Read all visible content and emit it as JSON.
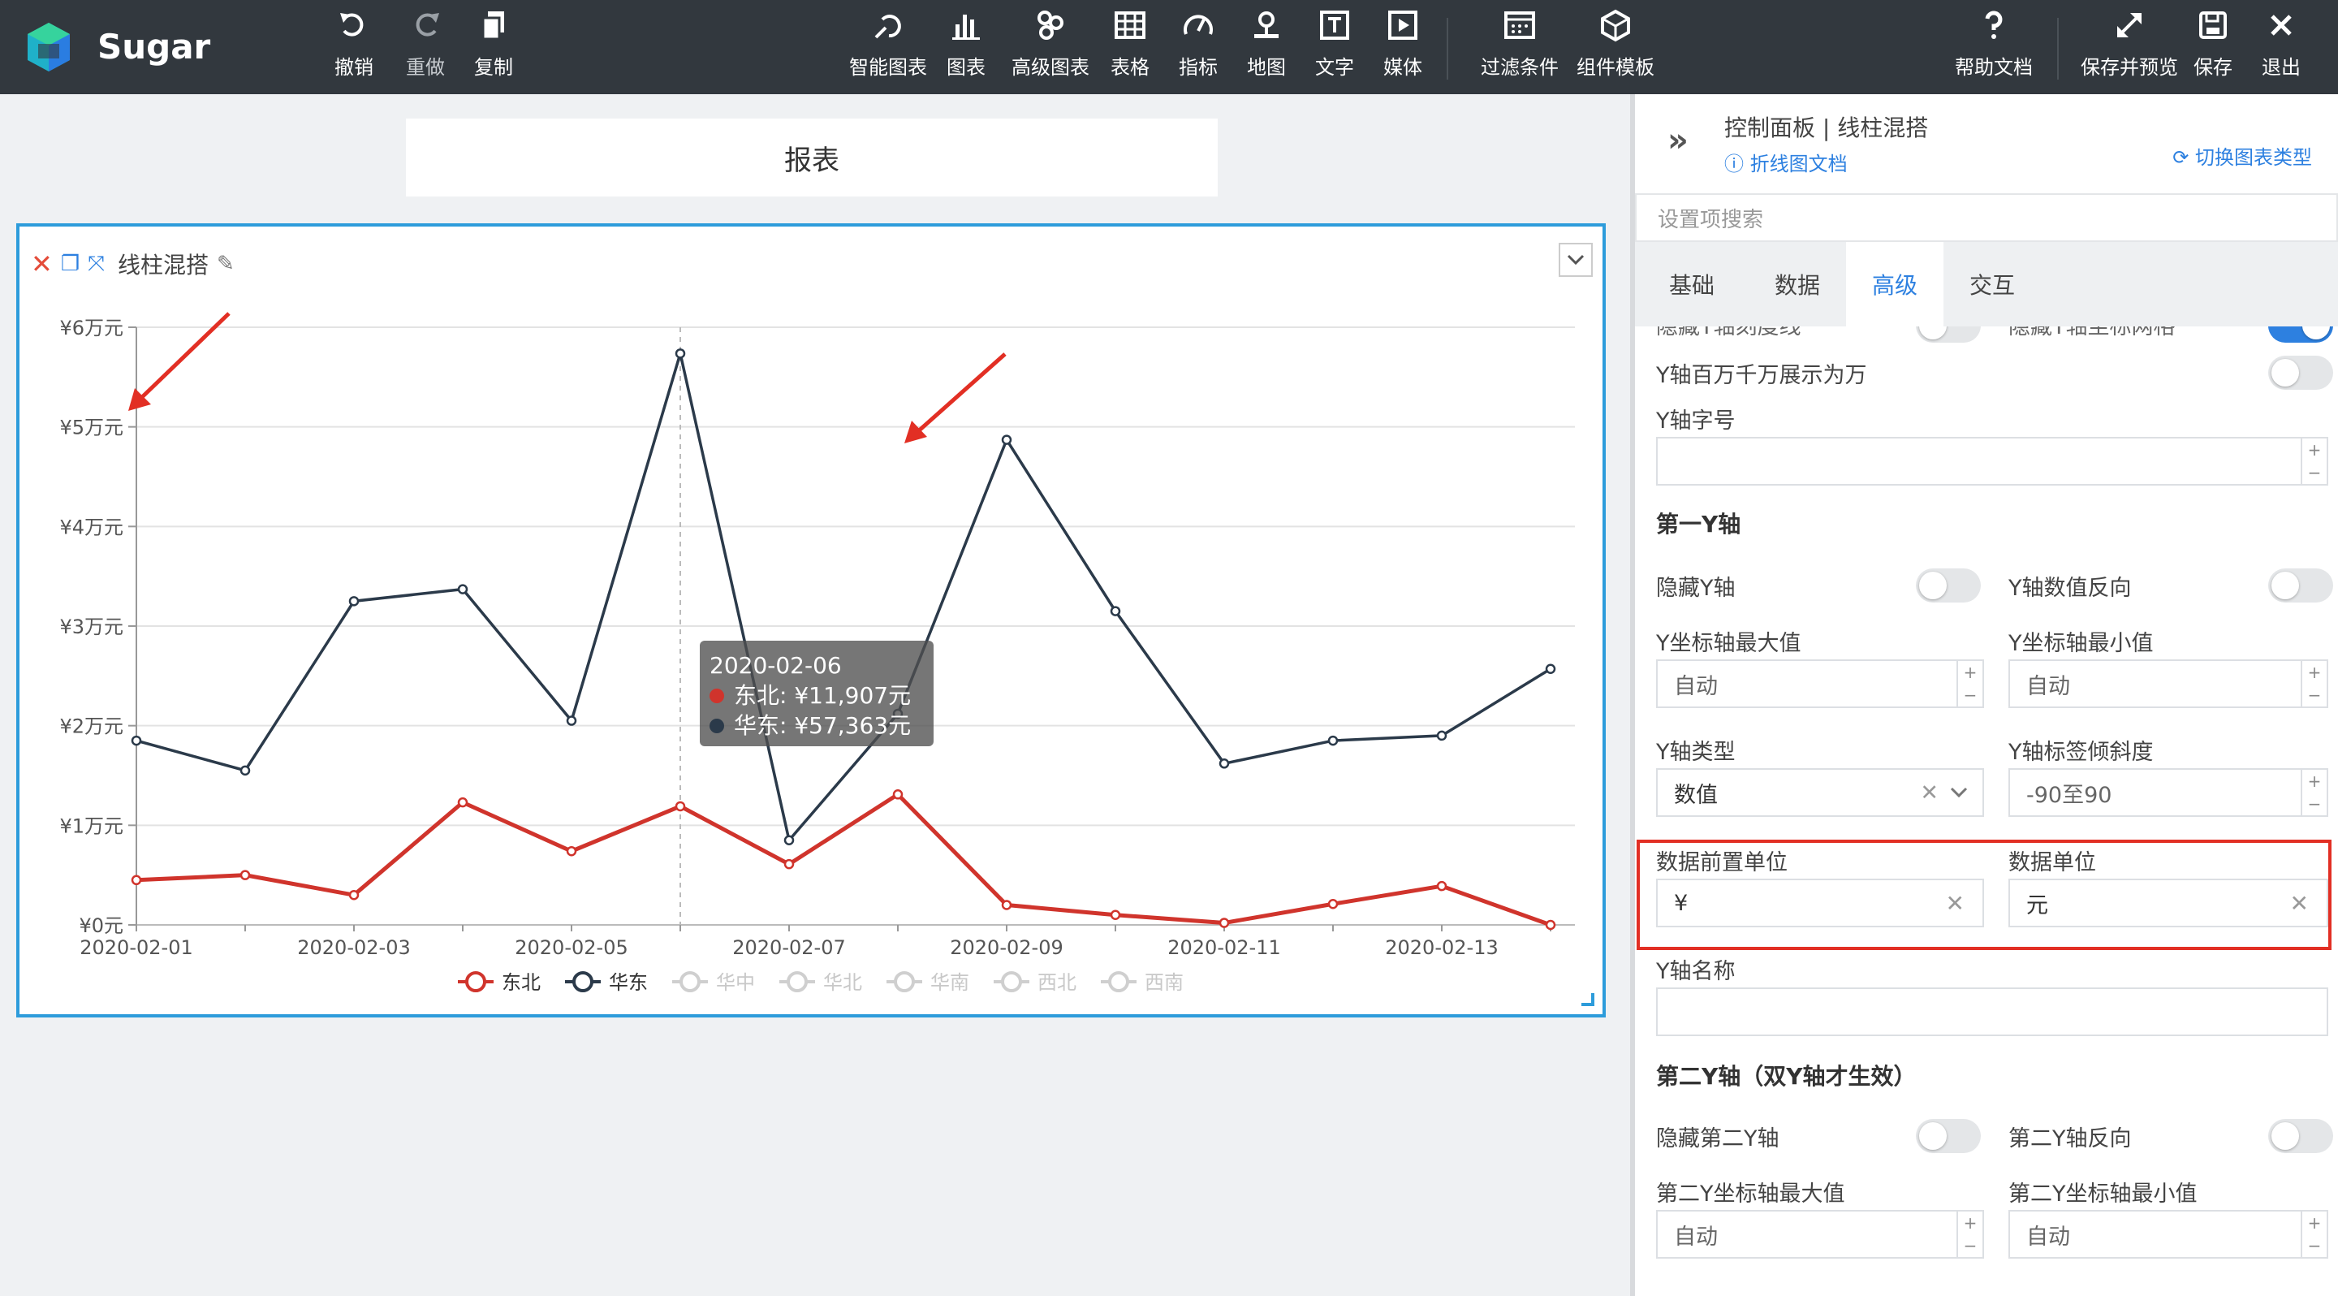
{
  "app": {
    "name": "Sugar"
  },
  "toolbar": {
    "left": [
      {
        "id": "undo",
        "label": "撤销",
        "icon": "undo-icon"
      },
      {
        "id": "redo",
        "label": "重做",
        "icon": "redo-icon"
      },
      {
        "id": "copy",
        "label": "复制",
        "icon": "copy-icon"
      }
    ],
    "center": [
      {
        "id": "smart-chart",
        "label": "智能图表",
        "icon": "smart-chart-icon"
      },
      {
        "id": "chart",
        "label": "图表",
        "icon": "bar-chart-icon"
      },
      {
        "id": "adv-chart",
        "label": "高级图表",
        "icon": "advanced-chart-icon"
      },
      {
        "id": "table",
        "label": "表格",
        "icon": "table-icon"
      },
      {
        "id": "metric",
        "label": "指标",
        "icon": "gauge-icon"
      },
      {
        "id": "map",
        "label": "地图",
        "icon": "map-pin-icon"
      },
      {
        "id": "text",
        "label": "文字",
        "icon": "text-icon"
      },
      {
        "id": "media",
        "label": "媒体",
        "icon": "media-icon"
      },
      {
        "id": "filter",
        "label": "过滤条件",
        "icon": "filter-icon"
      },
      {
        "id": "template",
        "label": "组件模板",
        "icon": "cube-icon"
      }
    ],
    "right": [
      {
        "id": "help",
        "label": "帮助文档",
        "icon": "help-icon"
      },
      {
        "id": "save-preview",
        "label": "保存并预览",
        "icon": "expand-icon"
      },
      {
        "id": "save",
        "label": "保存",
        "icon": "save-icon"
      },
      {
        "id": "exit",
        "label": "退出",
        "icon": "close-icon"
      }
    ]
  },
  "report": {
    "title": "报表"
  },
  "card": {
    "title": "线柱混搭"
  },
  "chart_data": {
    "type": "line",
    "x": [
      "2020-02-01",
      "2020-02-02",
      "2020-02-03",
      "2020-02-04",
      "2020-02-05",
      "2020-02-06",
      "2020-02-07",
      "2020-02-08",
      "2020-02-09",
      "2020-02-10",
      "2020-02-11",
      "2020-02-12",
      "2020-02-13",
      "2020-02-14"
    ],
    "x_tick_labels": [
      "2020-02-01",
      "2020-02-03",
      "2020-02-05",
      "2020-02-07",
      "2020-02-09",
      "2020-02-11",
      "2020-02-13"
    ],
    "y_tick_labels": [
      "¥0元",
      "¥1万元",
      "¥2万元",
      "¥3万元",
      "¥4万元",
      "¥5万元",
      "¥6万元"
    ],
    "ylim": [
      0,
      60000
    ],
    "grid": true,
    "series": [
      {
        "name": "东北",
        "color": "#d0342c",
        "active": true,
        "values": [
          4500,
          5000,
          3000,
          12300,
          7400,
          11907,
          6100,
          13100,
          2000,
          1000,
          200,
          2100,
          3900,
          0
        ]
      },
      {
        "name": "华东",
        "color": "#2b3a4a",
        "active": true,
        "values": [
          18500,
          15500,
          32500,
          33700,
          20500,
          57363,
          8500,
          21200,
          48700,
          31500,
          16200,
          18500,
          19000,
          25700
        ]
      },
      {
        "name": "华中",
        "color": "#c8c8c8",
        "active": false,
        "values": []
      },
      {
        "name": "华北",
        "color": "#c8c8c8",
        "active": false,
        "values": []
      },
      {
        "name": "华南",
        "color": "#c8c8c8",
        "active": false,
        "values": []
      },
      {
        "name": "西北",
        "color": "#c8c8c8",
        "active": false,
        "values": []
      },
      {
        "name": "西南",
        "color": "#c8c8c8",
        "active": false,
        "values": []
      }
    ],
    "legend": "bottom",
    "tooltip": {
      "date": "2020-02-06",
      "rows": [
        {
          "series": "东北",
          "text": "东北: ¥11,907元",
          "color": "#d0342c"
        },
        {
          "series": "华东",
          "text": "华东: ¥57,363元",
          "color": "#2b3a4a"
        }
      ]
    }
  },
  "panel": {
    "title": "控制面板 | 线柱混搭",
    "doc_link": "折线图文档",
    "switch_type": "切换图表类型",
    "search_placeholder": "设置项搜索",
    "tabs": [
      "基础",
      "数据",
      "高级",
      "交互"
    ],
    "active_tab": "高级",
    "cut_labels": {
      "left": "隐藏Y轴刻度线",
      "right": "隐藏Y轴坐标网格"
    },
    "y_million_label": "Y轴百万千万展示为万",
    "y_font_size_label": "Y轴字号",
    "y_font_size_value": "",
    "first_y_section": "第一Y轴",
    "hide_y_label": "隐藏Y轴",
    "y_reverse_label": "Y轴数值反向",
    "y_max_label": "Y坐标轴最大值",
    "y_max_value": "自动",
    "y_min_label": "Y坐标轴最小值",
    "y_min_value": "自动",
    "y_type_label": "Y轴类型",
    "y_type_value": "数值",
    "y_tilt_label": "Y轴标签倾斜度",
    "y_tilt_placeholder": "-90至90",
    "prefix_label": "数据前置单位",
    "prefix_value": "¥",
    "unit_label": "数据单位",
    "unit_value": "元",
    "y_name_label": "Y轴名称",
    "y_name_value": "",
    "second_y_section": "第二Y轴（双Y轴才生效）",
    "hide_y2_label": "隐藏第二Y轴",
    "y2_reverse_label": "第二Y轴反向",
    "y2_max_label": "第二Y坐标轴最大值",
    "y2_max_value": "自动",
    "y2_min_label": "第二Y坐标轴最小值",
    "y2_min_value": "自动"
  }
}
